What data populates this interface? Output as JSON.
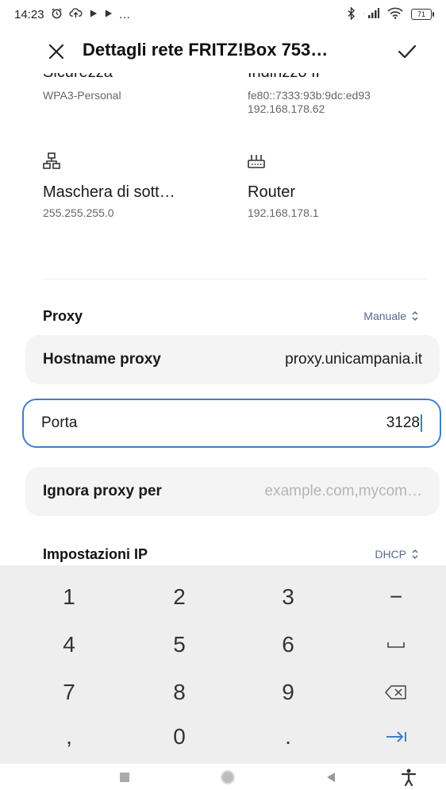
{
  "status_bar": {
    "time": "14:23",
    "extra": "…",
    "battery": "71"
  },
  "header": {
    "title": "Dettagli rete FRITZ!Box 753…"
  },
  "info": {
    "security_label": "Sicurezza",
    "security_value": "WPA3-Personal",
    "ip_label": "Indirizzo IP",
    "ip_value_1": "fe80::7333:93b:9dc:ed93",
    "ip_value_2": "192.168.178.62",
    "mask_label": "Maschera di sott…",
    "mask_value": "255.255.255.0",
    "router_label": "Router",
    "router_value": "192.168.178.1"
  },
  "proxy": {
    "title": "Proxy",
    "mode": "Manuale",
    "hostname_label": "Hostname proxy",
    "hostname_value": "proxy.unicampania.it",
    "port_label": "Porta",
    "port_value": "3128",
    "ignore_label": "Ignora proxy per",
    "ignore_placeholder": "example.com,mycom…"
  },
  "ip_settings": {
    "title": "Impostazioni IP",
    "mode": "DHCP"
  },
  "keypad": {
    "k1": "1",
    "k2": "2",
    "k3": "3",
    "minus": "−",
    "k4": "4",
    "k5": "5",
    "k6": "6",
    "space": "␣",
    "k7": "7",
    "k8": "8",
    "k9": "9",
    "comma": ",",
    "k0": "0",
    "dot": "."
  },
  "colors": {
    "accent": "#3f80c4",
    "field_bg": "#f4f4f4",
    "keypad_bg": "#eeeeee",
    "secondary_text": "#5a6a8a"
  }
}
